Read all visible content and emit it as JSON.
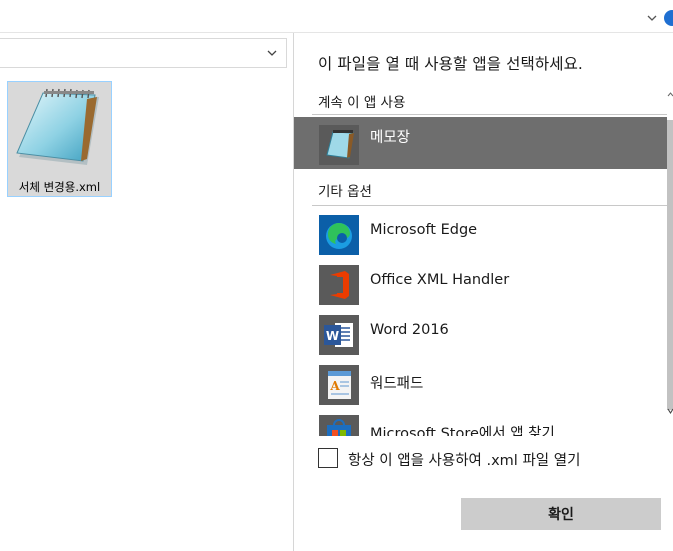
{
  "explorer": {
    "file": {
      "name": "서체 변경용.xml",
      "icon": "notepad-icon"
    }
  },
  "dialog": {
    "title": "이 파일을 열 때 사용할 앱을 선택하세요.",
    "keep_section": "계속 이 앱 사용",
    "selected_app": {
      "label": "메모장",
      "icon": "notepad-icon"
    },
    "other_section": "기타 옵션",
    "apps": [
      {
        "label": "Microsoft Edge",
        "icon": "edge-icon"
      },
      {
        "label": "Office XML Handler",
        "icon": "office-icon"
      },
      {
        "label": "Word 2016",
        "icon": "word-icon"
      },
      {
        "label": "워드패드",
        "icon": "wordpad-icon"
      },
      {
        "label": "Microsoft Store에서 앱 찾기",
        "icon": "store-icon"
      }
    ],
    "always_use_label": "항상 이 앱을 사용하여 .xml 파일 열기",
    "always_use_checked": false,
    "ok_label": "확인"
  },
  "colors": {
    "selection": "#6e6e6e",
    "button": "#cccccc",
    "accent": "#1f6fd1"
  }
}
